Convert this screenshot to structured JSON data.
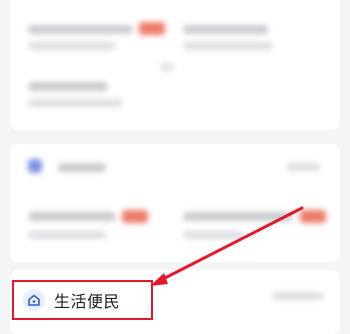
{
  "life_service": {
    "label": "生活便民",
    "icon": "house-icon"
  },
  "annotation": {
    "color": "#e1192a"
  },
  "colors": {
    "background": "#f4f5f7",
    "card": "#ffffff",
    "badge": "#ee7b67",
    "accent_blue": "#7d92e6"
  }
}
